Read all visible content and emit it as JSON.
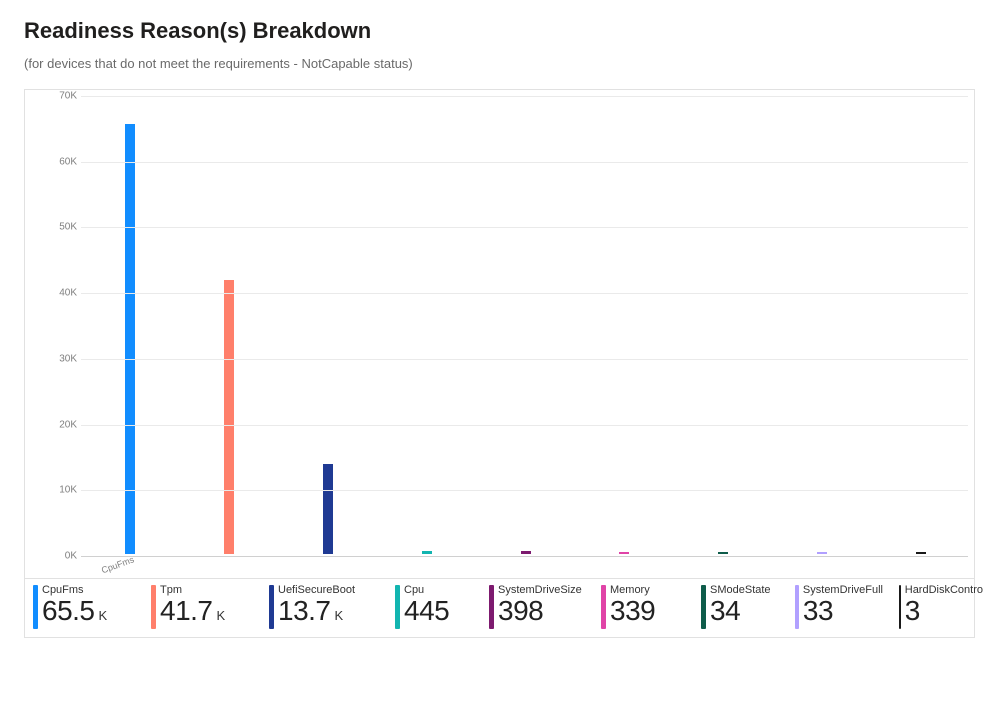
{
  "title": "Readiness Reason(s) Breakdown",
  "subtitle": "(for devices that do not meet the requirements - NotCapable status)",
  "chart_data": {
    "type": "bar",
    "title": "Readiness Reason(s) Breakdown",
    "xlabel": "",
    "ylabel": "",
    "ylim": [
      0,
      70000
    ],
    "yticks": [
      0,
      10000,
      20000,
      30000,
      40000,
      50000,
      60000,
      70000
    ],
    "ytick_labels": [
      "0K",
      "10K",
      "20K",
      "30K",
      "40K",
      "50K",
      "60K",
      "70K"
    ],
    "visible_category_labels": [
      "CpuFms"
    ],
    "series": [
      {
        "name": "CpuFms",
        "value": 65500,
        "display": "65.5",
        "unit": "K",
        "color": "#118dff"
      },
      {
        "name": "Tpm",
        "value": 41700,
        "display": "41.7",
        "unit": "K",
        "color": "#ff7f6b"
      },
      {
        "name": "UefiSecureBoot",
        "value": 13700,
        "display": "13.7",
        "unit": "K",
        "color": "#1f3a93"
      },
      {
        "name": "Cpu",
        "value": 445,
        "display": "445",
        "unit": "",
        "color": "#12b5b0"
      },
      {
        "name": "SystemDriveSize",
        "value": 398,
        "display": "398",
        "unit": "",
        "color": "#7d1a6f"
      },
      {
        "name": "Memory",
        "value": 339,
        "display": "339",
        "unit": "",
        "color": "#e044a7"
      },
      {
        "name": "SModeState",
        "value": 34,
        "display": "34",
        "unit": "",
        "color": "#0e5c4a"
      },
      {
        "name": "SystemDriveFull",
        "value": 33,
        "display": "33",
        "unit": "",
        "color": "#b1a0ff"
      },
      {
        "name": "HardDiskContro",
        "value": 3,
        "display": "3",
        "unit": "",
        "color": "#1a1a1a"
      }
    ]
  },
  "card_widths": [
    118,
    118,
    126,
    94,
    112,
    100,
    94,
    104,
    100
  ]
}
